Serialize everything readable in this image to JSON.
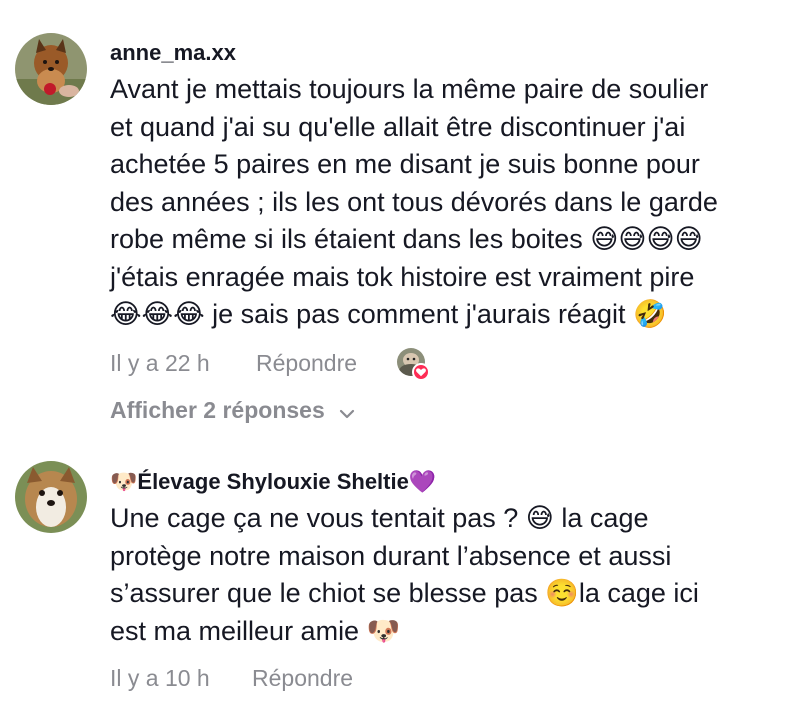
{
  "comments": [
    {
      "username": "anne_ma.xx",
      "lines": [
        "Avant je mettais toujours la même paire de soulier",
        "et quand j'ai su qu'elle allait être discontinuer j'ai",
        "achetée 5 paires en me disant je suis bonne pour",
        "des années ; ils les ont tous dévorés dans le garde",
        "robe même si ils étaient dans les boites 😅😅😅😅",
        "j'étais enragée mais tok histoire est vraiment pire",
        "😂😂😂 je sais pas comment j'aurais réagit 🤣"
      ],
      "time": "Il y a 22 h",
      "reply_label": "Répondre",
      "creator_liked": true,
      "view_replies": "Afficher 2 réponses"
    },
    {
      "username": "🐶Élevage Shylouxie Sheltie💜",
      "lines": [
        "Une cage ça ne vous tentait pas ? 😅 la cage",
        "protège notre maison durant l’absence et aussi",
        "s’assurer que le chiot se blesse pas ☺️la cage ici",
        "est ma meilleur amie 🐶"
      ],
      "time": "Il y a 10 h",
      "reply_label": "Répondre"
    }
  ],
  "colors": {
    "text": "#161823",
    "muted": "#8a8b91",
    "like": "#fe2c55"
  }
}
